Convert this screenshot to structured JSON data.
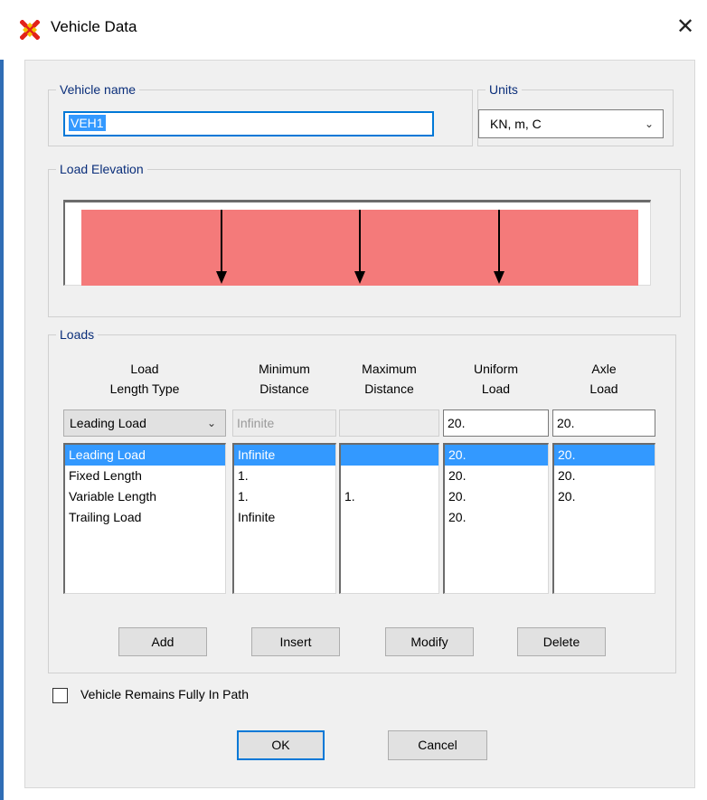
{
  "window": {
    "title": "Vehicle Data",
    "close_glyph": "✕",
    "icon": "sap2000-app-icon"
  },
  "vehicle_name": {
    "legend": "Vehicle name",
    "value": "VEH1"
  },
  "units": {
    "legend": "Units",
    "value": "KN, m, C"
  },
  "load_elevation": {
    "legend": "Load Elevation",
    "band_color": "#f47a7a",
    "axle_count": 3
  },
  "loads": {
    "legend": "Loads",
    "headers": [
      {
        "line1": "Load",
        "line2": "Length Type"
      },
      {
        "line1": "Minimum",
        "line2": "Distance"
      },
      {
        "line1": "Maximum",
        "line2": "Distance"
      },
      {
        "line1": "Uniform",
        "line2": "Load"
      },
      {
        "line1": "Axle",
        "line2": "Load"
      }
    ],
    "entry": {
      "length_type": "Leading Load",
      "min_distance": "Infinite",
      "max_distance": "",
      "uniform_load": "20.",
      "axle_load": "20."
    },
    "rows": [
      {
        "type": "Leading Load",
        "min": "Infinite",
        "max": "",
        "uniform": "20.",
        "axle": "20."
      },
      {
        "type": "Fixed Length",
        "min": "1.",
        "max": "",
        "uniform": "20.",
        "axle": "20."
      },
      {
        "type": "Variable Length",
        "min": "1.",
        "max": "1.",
        "uniform": "20.",
        "axle": "20."
      },
      {
        "type": "Trailing Load",
        "min": "Infinite",
        "max": "",
        "uniform": "20.",
        "axle": ""
      }
    ],
    "buttons": {
      "add": "Add",
      "insert": "Insert",
      "modify": "Modify",
      "delete": "Delete"
    }
  },
  "options": {
    "fully_in_path_label": "Vehicle Remains Fully In Path",
    "fully_in_path_checked": false
  },
  "dialog_buttons": {
    "ok": "OK",
    "cancel": "Cancel"
  },
  "colors": {
    "accent": "#0078d7",
    "selection": "#3399ff",
    "legend_text": "#0a2e7a"
  }
}
